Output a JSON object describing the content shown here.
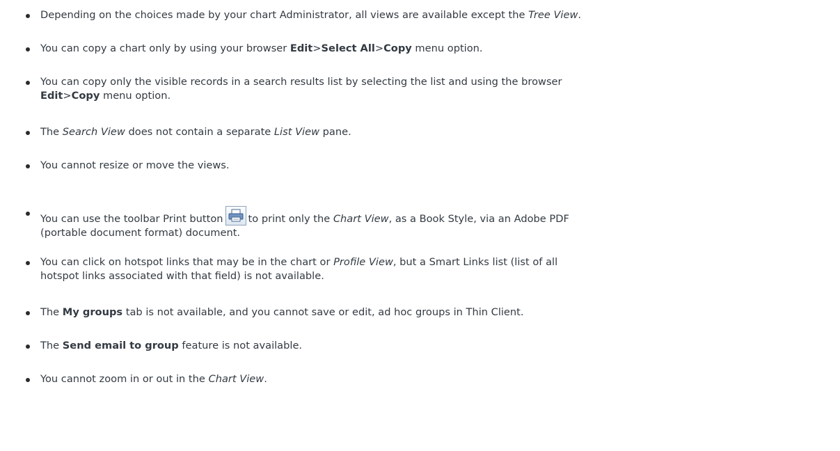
{
  "bullets": [
    {
      "t0": "Depending on the choices made by your chart Administrator, all views are available except the ",
      "i1": "Tree View",
      "t2": "."
    },
    {
      "t0": "You can copy a chart only by using your browser ",
      "b1": "Edit",
      "t2": ">",
      "b3": "Select All",
      "t4": ">",
      "b5": "Copy",
      "t6": " menu option."
    },
    {
      "line1": "You can copy only the visible records in a search results list by selecting the list and using the browser",
      "b1": "Edit",
      "t2": ">",
      "b3": "Copy",
      "t4": " menu option."
    },
    {
      "t0": "The ",
      "i1": "Search View",
      "t2": " does not contain a separate ",
      "i3": "List View",
      "t4": " pane."
    },
    {
      "t0": "You cannot resize or move the views."
    },
    {
      "t0": "You can use the toolbar Print button",
      "t1": "to print only the ",
      "i2": "Chart View",
      "t3": ", as a Book Style, via an Adobe PDF",
      "line2": "(portable document format) document."
    },
    {
      "t0": "You can click on hotspot links that may be in the chart or ",
      "i1": "Profile View",
      "t2": ", but a Smart Links list (list of all",
      "line2": "hotspot links associated with that field) is not available."
    },
    {
      "t0": "The ",
      "b1": "My groups",
      "t2": " tab is not available, and you cannot save or edit, ad hoc groups in Thin Client."
    },
    {
      "t0": "The ",
      "b1": "Send email to group",
      "t2": " feature is not available."
    },
    {
      "t0": "You cannot zoom in or out in the ",
      "i1": "Chart View",
      "t2": "."
    }
  ],
  "print_button": {
    "icon": "printer-icon"
  }
}
